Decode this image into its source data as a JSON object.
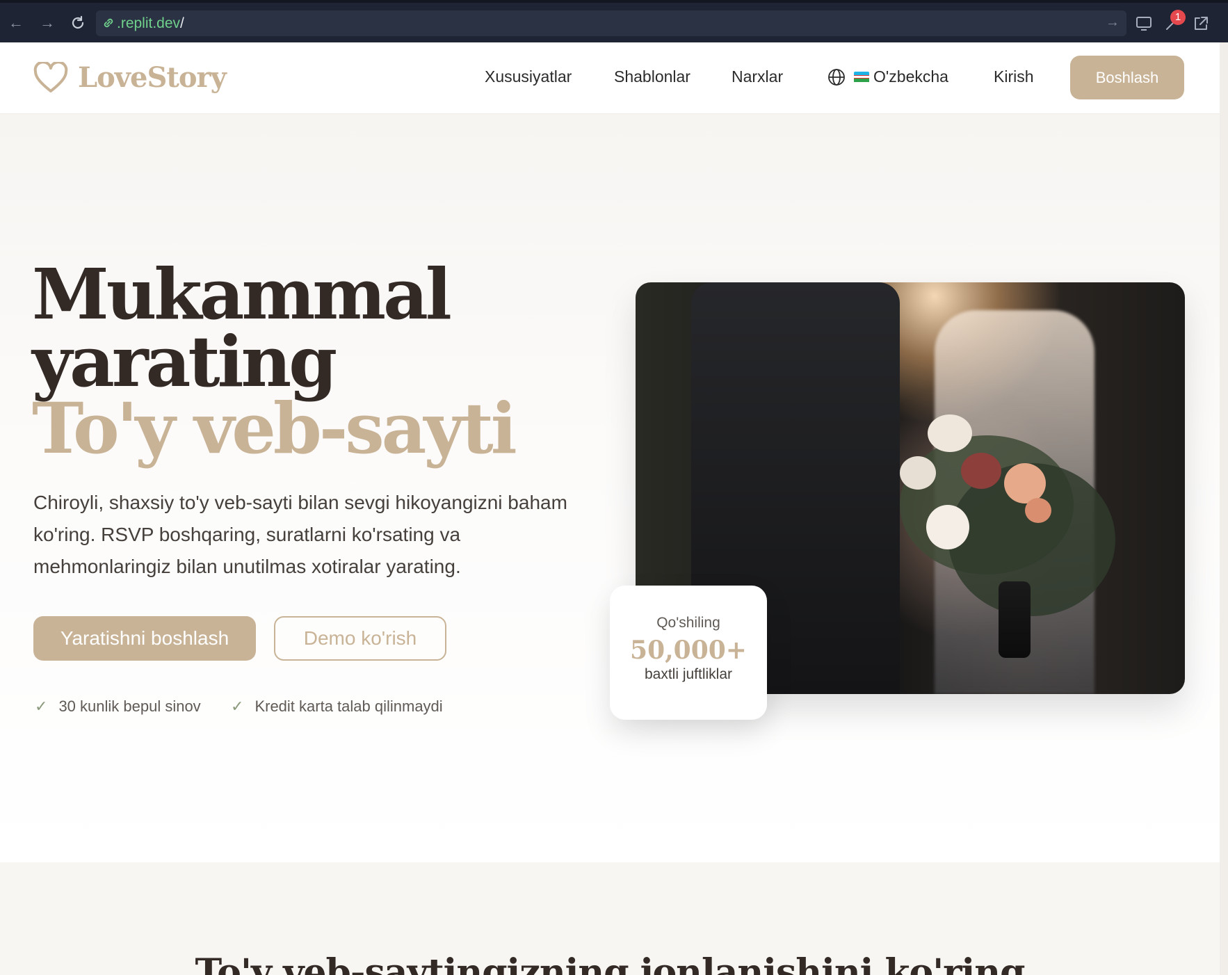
{
  "browser": {
    "url_domain": ".replit.dev",
    "url_path": "/",
    "notification_count": "1"
  },
  "header": {
    "logo_text": "LoveStory",
    "nav": [
      "Xususiyatlar",
      "Shablonlar",
      "Narxlar"
    ],
    "language": "O'zbekcha",
    "login": "Kirish",
    "cta": "Boshlash"
  },
  "hero": {
    "title_line1": "Mukammal",
    "title_line2": "yarating",
    "title_line3": "To'y veb-sayti",
    "description": "Chiroyli, shaxsiy to'y veb-sayti bilan sevgi hikoyangizni baham ko'ring. RSVP boshqaring, suratlarni ko'rsating va mehmonlaringiz bilan unutilmas xotiralar yarating.",
    "primary_button": "Yaratishni boshlash",
    "secondary_button": "Demo ko'rish",
    "checks": [
      "30 kunlik bepul sinov",
      "Kredit karta talab qilinmaydi"
    ],
    "stat": {
      "label": "Qo'shiling",
      "value": "50,000+",
      "sub": "baxtli juftliklar"
    }
  },
  "section2": {
    "title": "To'y veb-saytingizning jonlanishini ko'ring"
  },
  "colors": {
    "accent": "#c9b396",
    "heading": "#332a26",
    "chrome": "#1e2433"
  }
}
